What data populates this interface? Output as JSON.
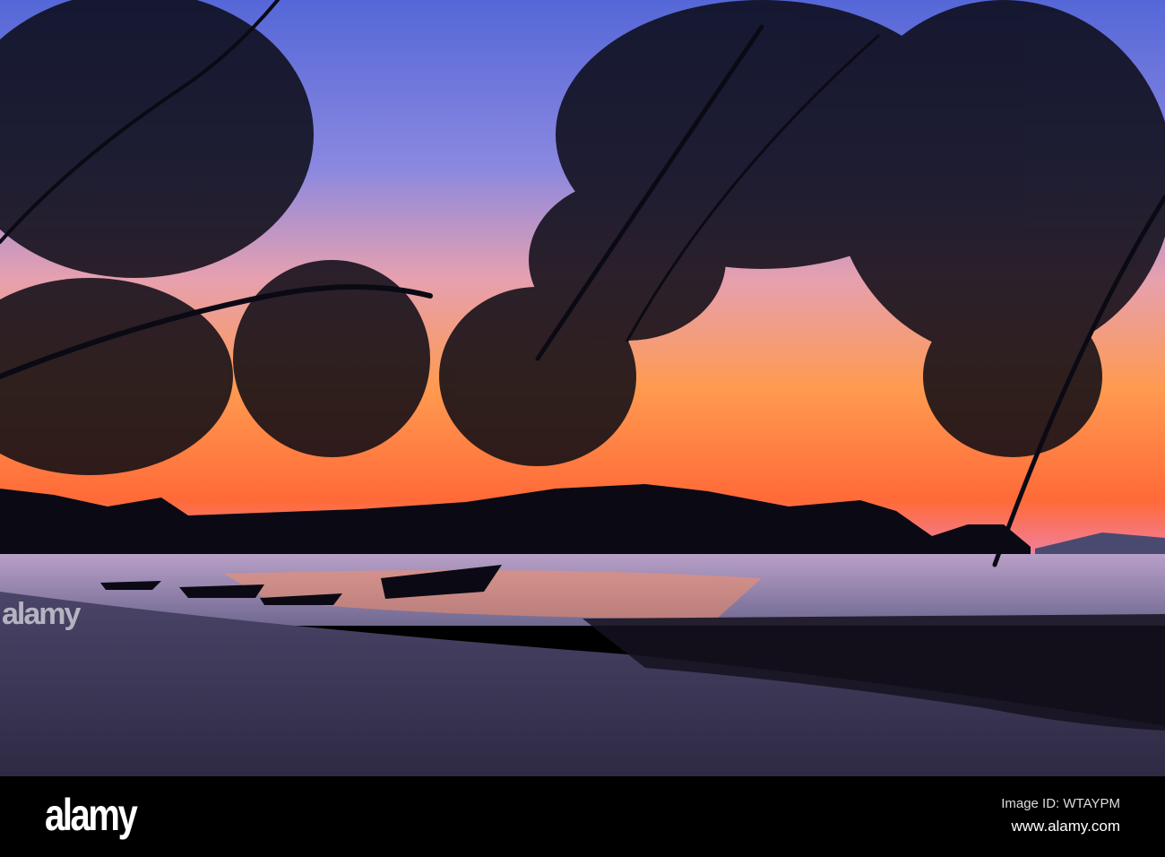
{
  "watermark": {
    "logo": "alamy",
    "overlay_text": "alamy"
  },
  "footer": {
    "logo": "alamy",
    "image_id": "Image ID: WTAYPM",
    "url": "www.alamy.com"
  },
  "colors": {
    "sky_top": "#6a7be0",
    "sky_mid": "#f09070",
    "horizon": "#ff6a30",
    "sand": "#3a3550",
    "silhouette": "#0b0a14"
  }
}
